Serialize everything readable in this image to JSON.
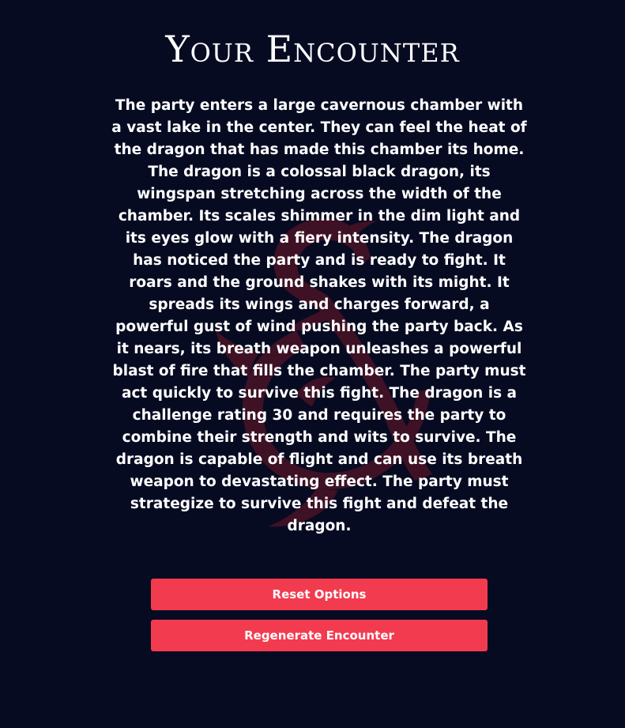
{
  "page": {
    "title": "Your Encounter",
    "description": "The party enters a large cavernous chamber with a vast lake in the center. They can feel the heat of the dragon that has made this chamber its home. The dragon is a colossal black dragon, its wingspan stretching across the width of the chamber. Its scales shimmer in the dim light and its eyes glow with a fiery intensity. The dragon has noticed the party and is ready to fight. It roars and the ground shakes with its might. It spreads its wings and charges forward, a powerful gust of wind pushing the party back. As it nears, its breath weapon unleashes a powerful blast of fire that fills the chamber. The party must act quickly to survive this fight. The dragon is a challenge rating 30 and requires the party to combine their strength and wits to survive. The dragon is capable of flight and can use its breath weapon to devastating effect. The party must strategize to survive this fight and defeat the dragon."
  },
  "actions": {
    "reset_label": "Reset Options",
    "regenerate_label": "Regenerate Encounter"
  },
  "watermark": {
    "icon": "dragon-ampersand-logo-icon",
    "color": "#8b1a2b"
  },
  "colors": {
    "background": "#070b22",
    "button": "#f23b4f",
    "text": "#ffffff"
  }
}
